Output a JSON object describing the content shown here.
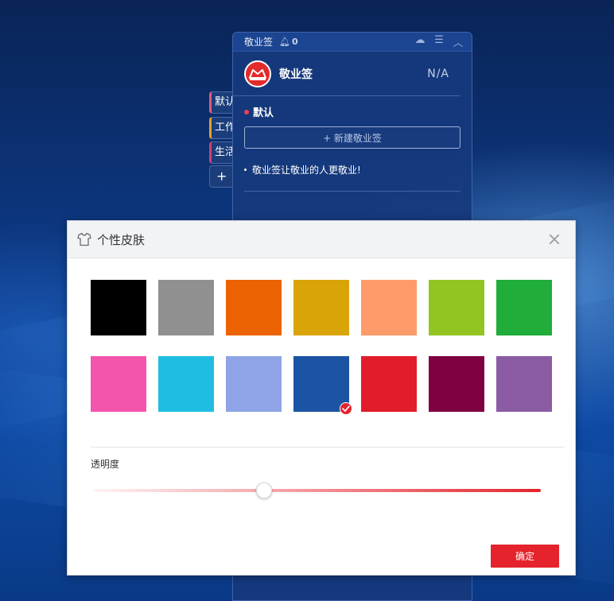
{
  "side_tabs": [
    {
      "label": "默认"
    },
    {
      "label": "工作"
    },
    {
      "label": "生活"
    },
    {
      "label": "+"
    }
  ],
  "widget": {
    "title": "敬业签",
    "reminder_count": "0",
    "app_name": "敬业签",
    "user_status": "N/A",
    "folder_name": "默认",
    "new_note_label": "+ 新建敬业签",
    "notes": [
      {
        "text": "敬业签让敬业的人更敬业!"
      }
    ]
  },
  "dialog": {
    "title": "个性皮肤",
    "opacity_label": "透明度",
    "opacity_value": 0.38,
    "confirm_label": "确定",
    "selected_index": 10,
    "swatches": [
      {
        "color": "#000000"
      },
      {
        "color": "#909090"
      },
      {
        "color": "#ec6303"
      },
      {
        "color": "#d9a408"
      },
      {
        "color": "#fe9b6a"
      },
      {
        "color": "#92c522"
      },
      {
        "color": "#21ad3a"
      },
      {
        "color": "#f355ad"
      },
      {
        "color": "#20bde2"
      },
      {
        "color": "#8fa4e6"
      },
      {
        "color": "#1b54a2"
      },
      {
        "color": "#e21c2a"
      },
      {
        "color": "#7e0040"
      },
      {
        "color": "#8b5ba4"
      }
    ]
  },
  "colors": {
    "accent": "#e4232c",
    "widget_bg": "#163a7d"
  }
}
